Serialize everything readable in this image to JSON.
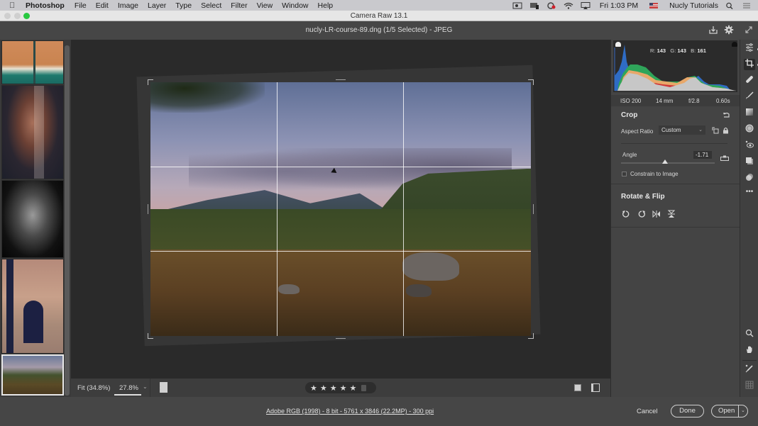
{
  "menubar": {
    "apple_icon": "apple-logo",
    "app_name": "Photoshop",
    "items": [
      "File",
      "Edit",
      "Image",
      "Layer",
      "Type",
      "Select",
      "Filter",
      "View",
      "Window",
      "Help"
    ],
    "status_icons": [
      "camera-recording-icon",
      "display-icon",
      "creative-cloud-icon",
      "wifi-icon",
      "airplay-icon"
    ],
    "clock": "Fri 1:03 PM",
    "flag_icon": "us-flag-icon",
    "user": "Nucly Tutorials",
    "search_icon": "spotlight-search-icon",
    "list_icon": "notification-center-icon"
  },
  "window": {
    "title": "Camera Raw 13.1"
  },
  "header": {
    "file_title": "nucly-LR-course-89.dng (1/5 Selected)  -  JPEG",
    "icons": [
      "save-image-icon",
      "settings-gear-icon",
      "fullscreen-icon"
    ]
  },
  "filmstrip": {
    "thumbnails": [
      {
        "name": "aerial-beach",
        "selected": false
      },
      {
        "name": "portrait-veil",
        "selected": false
      },
      {
        "name": "portrait-bw",
        "selected": false
      },
      {
        "name": "building-arch",
        "selected": false
      },
      {
        "name": "mountain-landscape",
        "selected": true
      }
    ]
  },
  "canvas_bottom": {
    "fit_label": "Fit (34.8%)",
    "zoom_value": "27.8%",
    "zoom_chevron": "⌄",
    "rating_stars": 5,
    "star_glyph": "★",
    "view_buttons": [
      "single-view",
      "before-after-view"
    ]
  },
  "histogram": {
    "r_label": "R:",
    "r_value": "143",
    "g_label": "G:",
    "g_value": "143",
    "b_label": "B:",
    "b_value": "161"
  },
  "exif": {
    "iso": "ISO 200",
    "focal": "14 mm",
    "aperture": "f/2.8",
    "shutter": "0.60s"
  },
  "crop_panel": {
    "title": "Crop",
    "aspect_ratio_label": "Aspect Ratio",
    "aspect_ratio_value": "Custom",
    "angle_label": "Angle",
    "angle_value": "-1.71",
    "angle_slider_fraction": 0.47,
    "constrain_label": "Constrain to Image",
    "constrain_checked": false
  },
  "rotate_panel": {
    "title": "Rotate & Flip",
    "buttons": [
      "rotate-left",
      "rotate-right",
      "flip-horizontal",
      "flip-vertical"
    ]
  },
  "toolstrip": {
    "top_tools": [
      "edit",
      "crop",
      "healing",
      "masking-brush",
      "linear-gradient",
      "radial-filter",
      "red-eye",
      "snapshots",
      "presets",
      "more"
    ],
    "active": "crop",
    "bottom_tools": [
      "zoom",
      "hand",
      "color-sampler",
      "grid-overlay"
    ]
  },
  "footer": {
    "workflow": "Adobe RGB (1998) - 8 bit - 5761 x 3846 (22.2MP) - 300 ppi",
    "cancel": "Cancel",
    "done": "Done",
    "open": "Open"
  }
}
